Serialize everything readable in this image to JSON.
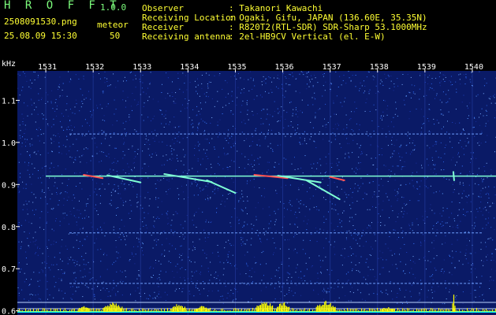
{
  "app": {
    "name": "H R O F F T",
    "version": "1.0.0",
    "filename": "2508091530.png",
    "datetime": "25.08.09 15:30",
    "meteor_label": "meteor",
    "meteor_count": "50"
  },
  "info": [
    {
      "key": "Observer",
      "value": ": Takanori Kawachi"
    },
    {
      "key": "Receiving Location",
      "value": ": Ogaki, Gifu, JAPAN (136.60E, 35.35N)"
    },
    {
      "key": "Receiver",
      "value": ": R820T2(RTL-SDR) SDR-Sharp 53.1000MHz"
    },
    {
      "key": "Receiving antenna",
      "value": ": 2el-HB9CV Vertical (el. E-W)"
    }
  ],
  "colors": {
    "background": "#000000",
    "spectrum_bg": "#0a1a66",
    "label_green": "#7cfc7c",
    "label_yellow": "#ffff33",
    "axis_text": "#ffffff",
    "signal_cyan": "#7fffd4",
    "signal_red": "#ff5050",
    "histogram": "#ffff00",
    "baseline_cyan": "#00ffff"
  },
  "chart_data": {
    "type": "heatmap",
    "ylabel": "kHz",
    "time_ticks": [
      "1531",
      "1532",
      "1533",
      "1534",
      "1535",
      "1536",
      "1537",
      "1538",
      "1539",
      "1540"
    ],
    "freq_ticks": [
      "1.1",
      "1.0",
      "0.9",
      "0.8",
      "0.7",
      "0.6"
    ],
    "time_range": [
      1530.4,
      1540.5
    ],
    "freq_range": [
      0.59,
      1.17
    ],
    "carrier_khz": 0.92,
    "constant_lines_khz": [
      1.02,
      0.785,
      0.665,
      0.62,
      0.605
    ],
    "meteor_traces": [
      {
        "t0": 1531.8,
        "t1": 1532.2,
        "f0": 0.923,
        "f1": 0.915,
        "color": "red"
      },
      {
        "t0": 1532.3,
        "t1": 1533.0,
        "f0": 0.922,
        "f1": 0.905,
        "color": "cyan"
      },
      {
        "t0": 1533.5,
        "t1": 1534.5,
        "f0": 0.925,
        "f1": 0.906,
        "color": "cyan"
      },
      {
        "t0": 1534.4,
        "t1": 1535.0,
        "f0": 0.91,
        "f1": 0.88,
        "color": "cyan"
      },
      {
        "t0": 1535.4,
        "t1": 1536.1,
        "f0": 0.923,
        "f1": 0.915,
        "color": "red"
      },
      {
        "t0": 1535.9,
        "t1": 1536.8,
        "f0": 0.921,
        "f1": 0.905,
        "color": "cyan"
      },
      {
        "t0": 1536.5,
        "t1": 1537.2,
        "f0": 0.91,
        "f1": 0.865,
        "color": "cyan"
      },
      {
        "t0": 1537.0,
        "t1": 1537.3,
        "f0": 0.918,
        "f1": 0.91,
        "color": "red"
      },
      {
        "t0": 1539.6,
        "t1": 1539.6,
        "f0": 0.93,
        "f1": 0.91,
        "color": "cyan"
      }
    ],
    "histogram_bursts": [
      {
        "t": 1531.8,
        "w": 0.25,
        "h": 0.4
      },
      {
        "t": 1532.4,
        "w": 0.4,
        "h": 0.55
      },
      {
        "t": 1533.8,
        "w": 0.3,
        "h": 0.5
      },
      {
        "t": 1534.3,
        "w": 0.3,
        "h": 0.35
      },
      {
        "t": 1535.6,
        "w": 0.35,
        "h": 0.7
      },
      {
        "t": 1536.0,
        "w": 0.25,
        "h": 0.6
      },
      {
        "t": 1536.9,
        "w": 0.4,
        "h": 0.65
      },
      {
        "t": 1538.2,
        "w": 0.3,
        "h": 0.3
      },
      {
        "t": 1539.6,
        "w": 0.05,
        "h": 1.0
      }
    ]
  }
}
